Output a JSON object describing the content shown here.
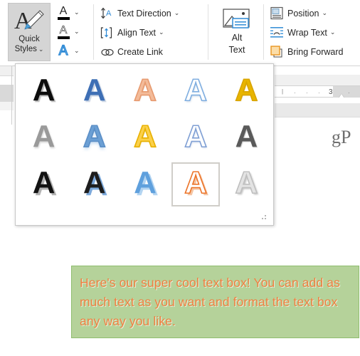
{
  "app": "Microsoft Word - Drawing Tools Format ribbon",
  "ribbon": {
    "quick_styles": {
      "label_line1": "Quick",
      "label_line2": "Styles",
      "chevron": "⌄",
      "icon": "wordart-a-brush-icon"
    },
    "text_fill_buttons": [
      {
        "name": "text-fill",
        "glyph": "A",
        "bar_color": "#000000",
        "glyph_color": "#262626",
        "chevron": "⌄"
      },
      {
        "name": "text-outline",
        "glyph": "A",
        "bar_color": "#000000",
        "glyph_color": "#262626",
        "chevron": "⌄"
      },
      {
        "name": "text-effects",
        "glyph": "A",
        "bar_color": "",
        "glyph_color": "#2e8ad6",
        "chevron": "⌄"
      }
    ],
    "text_group": [
      {
        "label": "Text Direction",
        "icon": "text-direction-icon",
        "chevron": "⌄"
      },
      {
        "label": "Align Text",
        "icon": "align-text-icon",
        "chevron": "⌄"
      },
      {
        "label": "Create Link",
        "icon": "create-link-icon",
        "chevron": ""
      }
    ],
    "alt_text": {
      "line1": "Alt",
      "line2": "Text",
      "icon": "alt-text-picture-icon"
    },
    "arrange_group": [
      {
        "label": "Position",
        "icon": "position-icon",
        "chevron": "⌄"
      },
      {
        "label": "Wrap Text",
        "icon": "wrap-text-icon",
        "chevron": "⌄"
      },
      {
        "label": "Bring Forward",
        "icon": "bring-forward-icon",
        "chevron": ""
      }
    ]
  },
  "gallery": {
    "name": "wordart-quick-styles-gallery",
    "columns": 5,
    "rows": 3,
    "selected_index": 13,
    "items": [
      {
        "index": 0,
        "glyph": "A",
        "label": "Fill Black Text 1 Shadow",
        "fill": "#0d0d0d",
        "outline": "",
        "shadow": "2px 2px 1px rgba(130,130,130,0.55)"
      },
      {
        "index": 1,
        "glyph": "A",
        "label": "Fill Blue Accent 1 Shadow",
        "fill": "#3e6fb5",
        "outline": "",
        "shadow": "2px 2px 1px rgba(150,170,200,0.5)"
      },
      {
        "index": 2,
        "glyph": "A",
        "label": "Fill Orange Accent 2 Shadow",
        "fill": "#f3bb99",
        "outline": "#e79a6f",
        "shadow": "1px 1px 1px rgba(220,170,140,0.5)"
      },
      {
        "index": 3,
        "glyph": "A",
        "label": "Fill White Outline Accent 1",
        "fill": "#ffffff",
        "outline": "#7faee0",
        "shadow": "1px 2px 2px rgba(170,190,215,0.55)"
      },
      {
        "index": 4,
        "glyph": "A",
        "label": "Fill Gold Accent 4 Soft Bevel",
        "fill": "#e8b500",
        "outline": "#d9a400",
        "shadow": "1px 1px 1px rgba(190,150,30,0.4)"
      },
      {
        "index": 5,
        "glyph": "A",
        "label": "Gradient Fill Gray",
        "fill": "#9a9a9a",
        "outline": "",
        "shadow": "1px 2px 2px rgba(190,190,190,0.6)"
      },
      {
        "index": 6,
        "glyph": "A",
        "label": "Gradient Fill Blue Accent 1",
        "fill": "#6b9fd4",
        "outline": "#5a8ec6",
        "shadow": "0 3px 4px rgba(175,205,235,0.8)"
      },
      {
        "index": 7,
        "glyph": "A",
        "label": "Gradient Fill Gold Accent 4",
        "fill": "#fbd04a",
        "outline": "#e8b100",
        "shadow": "1px 1px 1px rgba(220,180,40,0.5)"
      },
      {
        "index": 8,
        "glyph": "A",
        "label": "Fill White Outline Accent 2 Shadow",
        "fill": "#ffffff",
        "outline": "#7f9fd4",
        "shadow": "1px 2px 2px rgba(185,200,225,0.55)"
      },
      {
        "index": 9,
        "glyph": "A",
        "label": "Fill Gray 50 Accent 3 Sharp Bevel",
        "fill": "#5a5a5a",
        "outline": "",
        "shadow": "1px 1px 1px rgba(170,170,170,0.6)"
      },
      {
        "index": 10,
        "glyph": "A",
        "label": "Fill Black Text 1 Outline Background 1 Hard Shadow 1",
        "fill": "#121212",
        "outline": "",
        "shadow": "3px 3px 0 rgba(165,165,165,0.85)"
      },
      {
        "index": 11,
        "glyph": "A",
        "label": "Fill Black Text 1 Outline Background 1 Hard Shadow Accent 1",
        "fill": "#1d1d1d",
        "outline": "",
        "shadow": "3px 3px 0 rgba(110,160,215,0.9)"
      },
      {
        "index": 12,
        "glyph": "A",
        "label": "Fill Blue Accent 1 Outline Background 1 Hard Shadow Accent 1",
        "fill": "#5fa0dd",
        "outline": "",
        "shadow": "3px 3px 0 rgba(175,210,240,0.95)"
      },
      {
        "index": 13,
        "glyph": "A",
        "label": "Fill White Outline Accent 2 Hard Shadow Accent 2",
        "fill": "#ffffff",
        "outline": "#ec7327",
        "shadow": "3px 3px 0 rgba(235,150,90,0.55)"
      },
      {
        "index": 14,
        "glyph": "A",
        "label": "Fill Gray 25 Background 2 Inset Shadow",
        "fill": "#e3e3e3",
        "outline": "#bfbfbf",
        "shadow": "2px 2px 2px rgba(155,155,155,0.6)"
      }
    ],
    "resize_grip": "resize-grip-icon"
  },
  "document": {
    "ruler": {
      "number": "3",
      "ticks": [
        "|",
        "·",
        "·",
        "·",
        "·"
      ]
    },
    "watermark": "gP",
    "textbox": {
      "name": "green-text-box",
      "fill_color": "#b5d29a",
      "border_color": "#8fbd6e",
      "text_color": "#ee8040",
      "lines": [
        "Here's our super cool text box! You can add as",
        "much text as you want and format the text box",
        "any way you like."
      ]
    }
  }
}
